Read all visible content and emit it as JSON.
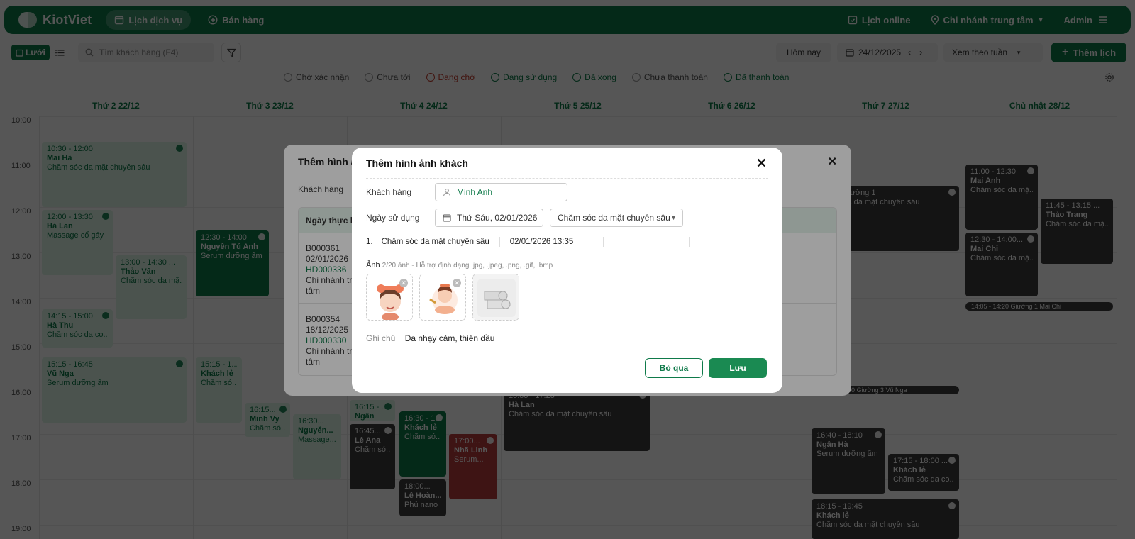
{
  "app": {
    "brand": "KiotViet",
    "nav": [
      {
        "label": "Lịch dịch vụ",
        "active": true
      },
      {
        "label": "Bán hàng",
        "active": false
      }
    ],
    "right": {
      "online": "Lịch online",
      "branch": "Chi nhánh trung tâm",
      "user": "Admin"
    }
  },
  "toolbar": {
    "grid_label": "Lưới",
    "search_placeholder": "Tìm khách hàng (F4)",
    "today": "Hôm nay",
    "date": "24/12/2025",
    "view": "Xem theo tuần",
    "add": "Thêm lịch"
  },
  "statuses": [
    {
      "label": "Chờ xác nhận",
      "color": "#555555"
    },
    {
      "label": "Chưa tới",
      "color": "#555555"
    },
    {
      "label": "Đang chờ",
      "color": "#c0392b"
    },
    {
      "label": "Đang sử dụng",
      "color": "#0f7a4a"
    },
    {
      "label": "Đã xong",
      "color": "#0f7a4a"
    },
    {
      "label": "Chưa thanh toán",
      "color": "#555555"
    },
    {
      "label": "Đã thanh toán",
      "color": "#0f7a4a"
    }
  ],
  "calendar": {
    "days": [
      "Thứ 2 22/12",
      "Thứ 3 23/12",
      "Thứ 4 24/12",
      "Thứ 5 25/12",
      "Thứ 6 26/12",
      "Thứ 7 27/12",
      "Chủ nhật 28/12"
    ],
    "hours": [
      "10:00",
      "11:00",
      "12:00",
      "13:00",
      "14:00",
      "15:00",
      "16:00",
      "17:00",
      "18:00",
      "19:00"
    ],
    "events": [
      {
        "time": "10:30 - 12:00",
        "name": "Mai Hà",
        "service": "Chăm sóc da mặt chuyên sâu",
        "style": "light"
      },
      {
        "time": "12:00 - 13:30",
        "name": "Hà Lan",
        "service": "Massage cổ gáy",
        "style": "light"
      },
      {
        "time": "13:00 - 14:30 ...",
        "name": "Thảo Vân",
        "service": "Chăm sóc da mặ...",
        "style": "light"
      },
      {
        "time": "14:15 - 15:00",
        "name": "Hà Thu",
        "service": "Chăm sóc da co...",
        "style": "light"
      },
      {
        "time": "15:15 - 16:45",
        "name": "Vũ Nga",
        "service": "Serum dưỡng ẩm",
        "style": "light"
      },
      {
        "time": "12:30 - 14:00",
        "name": "Nguyễn Tú Anh",
        "service": "Serum dưỡng ẩm",
        "style": "green"
      },
      {
        "time": "15:15 - 1...",
        "name": "Khách lẻ",
        "service": "Chăm só...",
        "style": "light"
      },
      {
        "time": "16:15...",
        "name": "Minh Vy",
        "service": "Chăm só...",
        "style": "light"
      },
      {
        "time": "16:30...",
        "name": "Nguyễn...",
        "service": "Massage...",
        "style": "light"
      },
      {
        "time": "16:15 - ...",
        "name": "Ngân",
        "service": "",
        "style": "light"
      },
      {
        "time": "16:45...",
        "name": "Lê Ana",
        "service": "Chăm só...",
        "style": "dark"
      },
      {
        "time": "16:30 - 1...",
        "name": "Khách lẻ",
        "service": "Chăm só...",
        "style": "green"
      },
      {
        "time": "18:00...",
        "name": "Lê Hoàn...",
        "service": "Phủ nano",
        "style": "dark"
      },
      {
        "time": "17:00...",
        "name": "Nhã Linh",
        "service": "Serum...",
        "style": "red"
      },
      {
        "time": "15:55 - 17:25",
        "name": "Hà Lan",
        "service": "Chăm sóc da mặt chuyên sâu",
        "style": "dark"
      },
      {
        "time": "11:00 - Giường 1",
        "name": "",
        "service": "Chăm sóc da mặt chuyên sâu",
        "style": "dark"
      },
      {
        "time": "16:40 - 18:10",
        "name": "Ngân Hà",
        "service": "Serum dưỡng ẩm",
        "style": "dark"
      },
      {
        "time": "17:15 - 18:00 ...",
        "name": "Khách lẻ",
        "service": "Chăm sóc da co...",
        "style": "dark"
      },
      {
        "time": "18:15 - 19:45",
        "name": "Khách lẻ",
        "service": "Chăm sóc da mặt chuyên sâu",
        "style": "dark"
      },
      {
        "time": "11:00 - 12:30",
        "name": "Mai Anh",
        "service": "Chăm sóc da mặ...",
        "style": "dark"
      },
      {
        "time": "12:30 - 14:00...",
        "name": "Mai Chi",
        "service": "Chăm sóc da mặ...",
        "style": "dark"
      },
      {
        "time": "11:45 - 13:15 ...",
        "name": "Thảo Trang",
        "service": "Chăm sóc da mặ...",
        "style": "dark"
      }
    ],
    "bars": [
      {
        "text": "15:55 - 16:10  Giường 3  Vũ Nga"
      },
      {
        "text": "14:05 - 14:20  Giường 1  Mai Chi"
      }
    ]
  },
  "back_modal": {
    "title": "Thêm hình ả",
    "customer_label": "Khách hàng",
    "col": "Ngày thực hi",
    "rows": [
      {
        "code": "B000361",
        "date": "02/01/2026",
        "invoice": "HD000336",
        "branch": "Chi nhánh tru",
        "branch2": "tâm"
      },
      {
        "code": "B000354",
        "date": "18/12/2025",
        "invoice": "HD000330",
        "branch": "Chi nhánh tru",
        "branch2": "tâm"
      }
    ]
  },
  "modal": {
    "title": "Thêm hình ảnh khách",
    "customer_label": "Khách hàng",
    "customer_value": "Minh Anh",
    "date_label": "Ngày sử dụng",
    "date_value": "Thứ Sáu, 02/01/2026",
    "service_select": "Chăm sóc da mặt chuyên sâu",
    "service_line": {
      "index": "1.",
      "name": "Chăm sóc da mặt chuyên sâu",
      "datetime": "02/01/2026 13:35"
    },
    "photo_label": "Ảnh",
    "photo_hint": "2/20 ảnh - Hỗ trợ định dạng .jpg, .jpeg, .png, .gif, .bmp",
    "note_label": "Ghi chú",
    "note_value": "Da nhạy cảm, thiên dầu",
    "cancel": "Bỏ qua",
    "save": "Lưu"
  }
}
